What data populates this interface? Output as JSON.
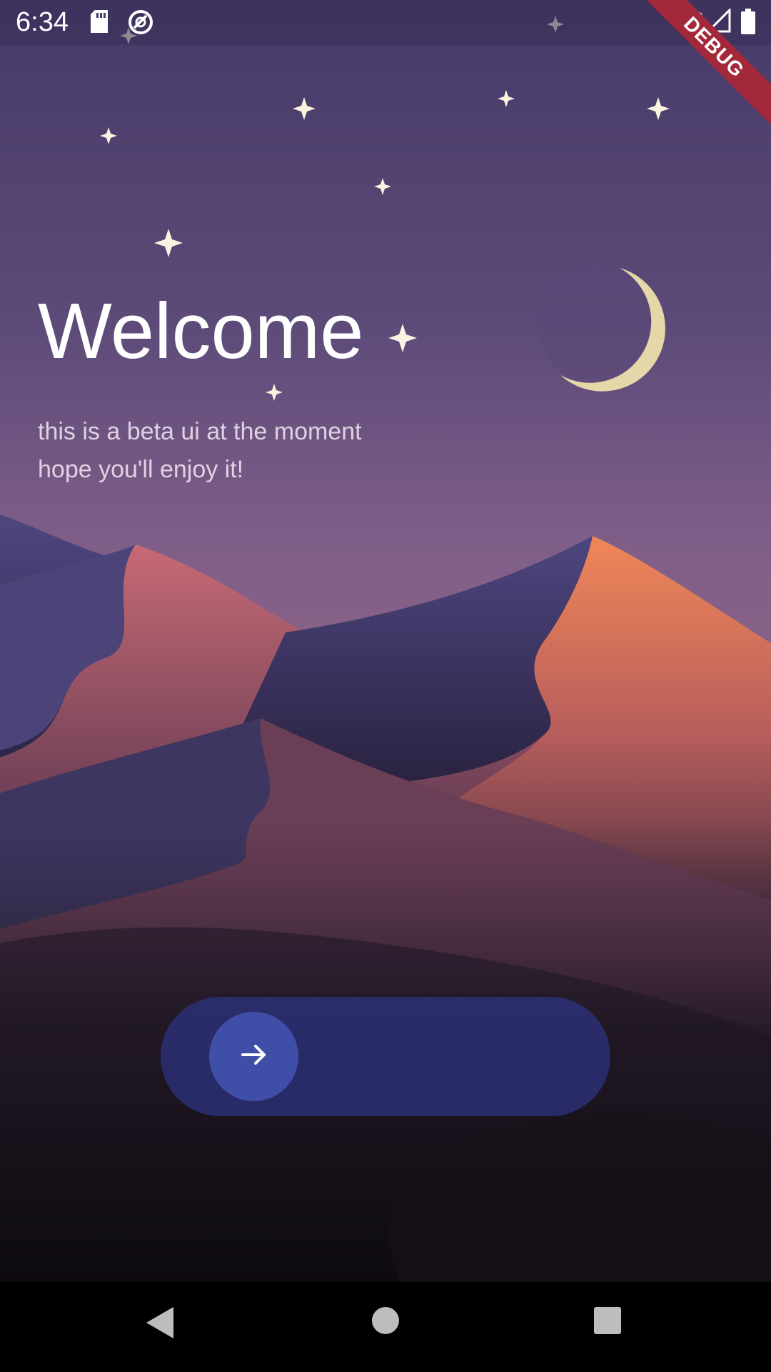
{
  "status_bar": {
    "time": "6:34",
    "icons_left": [
      "sd-card-icon",
      "sync-icon"
    ],
    "icons_right": [
      "wifi-icon",
      "cell-signal-icon",
      "battery-icon"
    ]
  },
  "debug_banner": {
    "label": "DEBUG",
    "color": "#a3283a"
  },
  "welcome": {
    "title": "Welcome",
    "subtitle_line1": "this is a beta ui at the moment",
    "subtitle_line2": "hope you'll enjoy it!"
  },
  "slider": {
    "icon": "arrow-right-icon",
    "knob_color": "#3f4fa8"
  },
  "nav_bar": {
    "buttons": [
      "back-icon",
      "home-icon",
      "recents-icon"
    ]
  },
  "colors": {
    "sky_top": "#4a3f6b",
    "sky_mid": "#7a5a86",
    "dune_orange": "#e07a55",
    "dune_purple": "#4a4580"
  }
}
